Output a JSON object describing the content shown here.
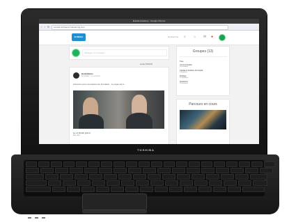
{
  "browser": {
    "title": "Eureka Academy - Google Chrome",
    "url": "eureka.curbaeva.fr/elearning.com"
  },
  "app": {
    "logo_text": "EUREKA",
    "search_label": "Rechercher",
    "composer_placeholder": "Partager un message...",
    "filter_label": "Lucie PISCIS",
    "feed_post": {
      "author": "Hoda Bensi",
      "meta": "Formation - il y a 2 jours",
      "text": "Annonce pour ma session de formation - Le sujet est à...",
      "caption": "Le vo Redel grand",
      "caption_sub": "Bien-Etre"
    },
    "groups_panel": {
      "title": "Groupes (13)",
      "filter": "Tous",
      "items": [
        {
          "name": "Communication",
          "sub": "18 membres"
        },
        {
          "name": "Capital et Solution Accomplie",
          "sub": "8 membres"
        },
        {
          "name": "Pratique",
          "sub": "15 membres"
        },
        {
          "name": "Questions",
          "sub": "10 membres"
        }
      ]
    },
    "courses_panel": {
      "title": "Parcours en cours"
    }
  },
  "laptop": {
    "brand": "TOSHIBA"
  },
  "colors": {
    "accent": "#1f8fd1",
    "avatar_green": "#19a54d"
  }
}
